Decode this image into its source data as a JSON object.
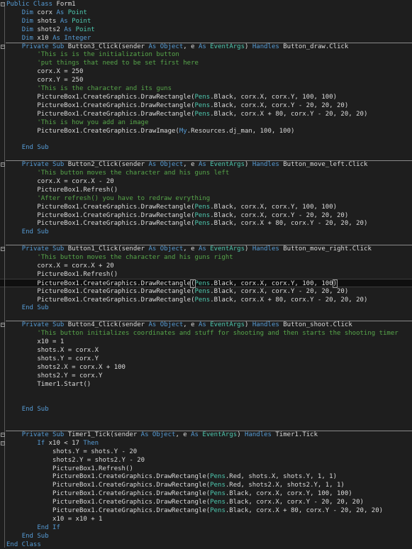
{
  "editor": {
    "code_lines": [
      [
        [
          "kw",
          "Public Class "
        ],
        [
          "tx",
          "Form1"
        ]
      ],
      [
        [
          "tx",
          "    "
        ],
        [
          "kw",
          "Dim "
        ],
        [
          "tx",
          "corx "
        ],
        [
          "kw",
          "As "
        ],
        [
          "ty",
          "Point"
        ]
      ],
      [
        [
          "tx",
          "    "
        ],
        [
          "kw",
          "Dim "
        ],
        [
          "tx",
          "shots "
        ],
        [
          "kw",
          "As "
        ],
        [
          "ty",
          "Point"
        ]
      ],
      [
        [
          "tx",
          "    "
        ],
        [
          "kw",
          "Dim "
        ],
        [
          "tx",
          "shots2 "
        ],
        [
          "kw",
          "As "
        ],
        [
          "ty",
          "Point"
        ]
      ],
      [
        [
          "tx",
          "    "
        ],
        [
          "kw",
          "Dim "
        ],
        [
          "tx",
          "x10 "
        ],
        [
          "kw",
          "As Integer"
        ]
      ],
      [
        [
          "tx",
          "    "
        ],
        [
          "kw",
          "Private Sub "
        ],
        [
          "tx",
          "Button3_Click(sender "
        ],
        [
          "kw",
          "As Object"
        ],
        [
          "tx",
          ", e "
        ],
        [
          "kw",
          "As "
        ],
        [
          "ty",
          "EventArgs"
        ],
        [
          "tx",
          ") "
        ],
        [
          "kw",
          "Handles "
        ],
        [
          "tx",
          "Button_draw.Click"
        ]
      ],
      [
        [
          "cm",
          "        'This is is the initialization button"
        ]
      ],
      [
        [
          "cm",
          "        'put things that need to be set first here"
        ]
      ],
      [
        [
          "tx",
          "        corx.X = 250"
        ]
      ],
      [
        [
          "tx",
          "        corx.Y = 250"
        ]
      ],
      [
        [
          "cm",
          "        'This is the character and its guns"
        ]
      ],
      [
        [
          "tx",
          "        PictureBox1.CreateGraphics.DrawRectangle("
        ],
        [
          "ty",
          "Pens"
        ],
        [
          "tx",
          ".Black, corx.X, corx.Y, 100, 100)"
        ]
      ],
      [
        [
          "tx",
          "        PictureBox1.CreateGraphics.DrawRectangle("
        ],
        [
          "ty",
          "Pens"
        ],
        [
          "tx",
          ".Black, corx.X, corx.Y - 20, 20, 20)"
        ]
      ],
      [
        [
          "tx",
          "        PictureBox1.CreateGraphics.DrawRectangle("
        ],
        [
          "ty",
          "Pens"
        ],
        [
          "tx",
          ".Black, corx.X + 80, corx.Y - 20, 20, 20)"
        ]
      ],
      [
        [
          "cm",
          "        'This is how you add an image"
        ]
      ],
      [
        [
          "tx",
          "        PictureBox1.CreateGraphics.DrawImage("
        ],
        [
          "kw",
          "My"
        ],
        [
          "tx",
          ".Resources.dj_man, 100, 100)"
        ]
      ],
      [],
      [
        [
          "tx",
          "    "
        ],
        [
          "kw",
          "End Sub"
        ]
      ],
      [],
      [
        [
          "tx",
          "    "
        ],
        [
          "kw",
          "Private Sub "
        ],
        [
          "tx",
          "Button2_Click(sender "
        ],
        [
          "kw",
          "As Object"
        ],
        [
          "tx",
          ", e "
        ],
        [
          "kw",
          "As "
        ],
        [
          "ty",
          "EventArgs"
        ],
        [
          "tx",
          ") "
        ],
        [
          "kw",
          "Handles "
        ],
        [
          "tx",
          "Button_move_left.Click"
        ]
      ],
      [
        [
          "cm",
          "        'This button moves the character and his guns left"
        ]
      ],
      [
        [
          "tx",
          "        corx.X = corx.X - 20"
        ]
      ],
      [
        [
          "tx",
          "        PictureBox1.Refresh()"
        ]
      ],
      [
        [
          "cm",
          "        'After refresh() you have to redraw evrything"
        ]
      ],
      [
        [
          "tx",
          "        PictureBox1.CreateGraphics.DrawRectangle("
        ],
        [
          "ty",
          "Pens"
        ],
        [
          "tx",
          ".Black, corx.X, corx.Y, 100, 100)"
        ]
      ],
      [
        [
          "tx",
          "        PictureBox1.CreateGraphics.DrawRectangle("
        ],
        [
          "ty",
          "Pens"
        ],
        [
          "tx",
          ".Black, corx.X, corx.Y - 20, 20, 20)"
        ]
      ],
      [
        [
          "tx",
          "        PictureBox1.CreateGraphics.DrawRectangle("
        ],
        [
          "ty",
          "Pens"
        ],
        [
          "tx",
          ".Black, corx.X + 80, corx.Y - 20, 20, 20)"
        ]
      ],
      [
        [
          "tx",
          "    "
        ],
        [
          "kw",
          "End Sub"
        ]
      ],
      [],
      [
        [
          "tx",
          "    "
        ],
        [
          "kw",
          "Private Sub "
        ],
        [
          "tx",
          "Button1_Click(sender "
        ],
        [
          "kw",
          "As Object"
        ],
        [
          "tx",
          ", e "
        ],
        [
          "kw",
          "As "
        ],
        [
          "ty",
          "EventArgs"
        ],
        [
          "tx",
          ") "
        ],
        [
          "kw",
          "Handles "
        ],
        [
          "tx",
          "Button_move_right.Click"
        ]
      ],
      [
        [
          "cm",
          "        'This button moves the character and his guns right"
        ]
      ],
      [
        [
          "tx",
          "        corx.X = corx.X + 20"
        ]
      ],
      [
        [
          "tx",
          "        PictureBox1.Refresh()"
        ]
      ],
      [
        [
          "tx",
          "        PictureBox1.CreateGraphics.DrawRectangle"
        ],
        [
          "br",
          "("
        ],
        [
          "ty",
          "Pens"
        ],
        [
          "tx",
          ".Black, corx.X, corx.Y, 100, 100"
        ],
        [
          "br",
          ")"
        ]
      ],
      [
        [
          "tx",
          "        PictureBox1.CreateGraphics.DrawRectangle("
        ],
        [
          "ty",
          "Pens"
        ],
        [
          "tx",
          ".Black, corx.X, corx.Y - 20, 20, 20)"
        ]
      ],
      [
        [
          "tx",
          "        PictureBox1.CreateGraphics.DrawRectangle("
        ],
        [
          "ty",
          "Pens"
        ],
        [
          "tx",
          ".Black, corx.X + 80, corx.Y - 20, 20, 20)"
        ]
      ],
      [
        [
          "tx",
          "    "
        ],
        [
          "kw",
          "End Sub"
        ]
      ],
      [],
      [
        [
          "tx",
          "    "
        ],
        [
          "kw",
          "Private Sub "
        ],
        [
          "tx",
          "Button4_Click(sender "
        ],
        [
          "kw",
          "As Object"
        ],
        [
          "tx",
          ", e "
        ],
        [
          "kw",
          "As "
        ],
        [
          "ty",
          "EventArgs"
        ],
        [
          "tx",
          ") "
        ],
        [
          "kw",
          "Handles "
        ],
        [
          "tx",
          "Button_shoot.Click"
        ]
      ],
      [
        [
          "cm",
          "        'This button initializes coordinates and stuff for shooting and then starts the shooting timer"
        ]
      ],
      [
        [
          "tx",
          "        x10 = 1"
        ]
      ],
      [
        [
          "tx",
          "        shots.X = corx.X"
        ]
      ],
      [
        [
          "tx",
          "        shots.Y = corx.Y"
        ]
      ],
      [
        [
          "tx",
          "        shots2.X = corx.X + 100"
        ]
      ],
      [
        [
          "tx",
          "        shots2.Y = corx.Y"
        ]
      ],
      [
        [
          "tx",
          "        Timer1.Start()"
        ]
      ],
      [],
      [],
      [
        [
          "tx",
          "    "
        ],
        [
          "kw",
          "End Sub"
        ]
      ],
      [],
      [],
      [
        [
          "tx",
          "    "
        ],
        [
          "kw",
          "Private Sub "
        ],
        [
          "tx",
          "Timer1_Tick(sender "
        ],
        [
          "kw",
          "As Object"
        ],
        [
          "tx",
          ", e "
        ],
        [
          "kw",
          "As "
        ],
        [
          "ty",
          "EventArgs"
        ],
        [
          "tx",
          ") "
        ],
        [
          "kw",
          "Handles "
        ],
        [
          "tx",
          "Timer1.Tick"
        ]
      ],
      [
        [
          "tx",
          "        "
        ],
        [
          "kw",
          "If "
        ],
        [
          "tx",
          "x10 < 17 "
        ],
        [
          "kw",
          "Then"
        ]
      ],
      [
        [
          "tx",
          "            shots.Y = shots.Y - 20"
        ]
      ],
      [
        [
          "tx",
          "            shots2.Y = shots2.Y - 20"
        ]
      ],
      [
        [
          "tx",
          "            PictureBox1.Refresh()"
        ]
      ],
      [
        [
          "tx",
          "            PictureBox1.CreateGraphics.DrawRectangle("
        ],
        [
          "ty",
          "Pens"
        ],
        [
          "tx",
          ".Red, shots.X, shots.Y, 1, 1)"
        ]
      ],
      [
        [
          "tx",
          "            PictureBox1.CreateGraphics.DrawRectangle("
        ],
        [
          "ty",
          "Pens"
        ],
        [
          "tx",
          ".Red, shots2.X, shots2.Y, 1, 1)"
        ]
      ],
      [
        [
          "tx",
          "            PictureBox1.CreateGraphics.DrawRectangle("
        ],
        [
          "ty",
          "Pens"
        ],
        [
          "tx",
          ".Black, corx.X, corx.Y, 100, 100)"
        ]
      ],
      [
        [
          "tx",
          "            PictureBox1.CreateGraphics.DrawRectangle("
        ],
        [
          "ty",
          "Pens"
        ],
        [
          "tx",
          ".Black, corx.X, corx.Y - 20, 20, 20)"
        ]
      ],
      [
        [
          "tx",
          "            PictureBox1.CreateGraphics.DrawRectangle("
        ],
        [
          "ty",
          "Pens"
        ],
        [
          "tx",
          ".Black, corx.X + 80, corx.Y - 20, 20, 20)"
        ]
      ],
      [
        [
          "tx",
          "            x10 = x10 + 1"
        ]
      ],
      [
        [
          "tx",
          "        "
        ],
        [
          "kw",
          "End If"
        ]
      ],
      [
        [
          "tx",
          "    "
        ],
        [
          "kw",
          "End Sub"
        ]
      ],
      [
        [
          "kw",
          "End Class"
        ]
      ]
    ],
    "current_line": 33,
    "fold_markers": [
      0,
      5,
      19,
      29,
      38,
      51,
      52
    ],
    "method_separators": [
      5,
      19,
      29,
      38,
      51
    ],
    "colors": {
      "background": "#1e1e1e",
      "keyword": "#569cd6",
      "type": "#4ec9b0",
      "comment": "#57a64a",
      "text": "#dcdcdc"
    }
  }
}
